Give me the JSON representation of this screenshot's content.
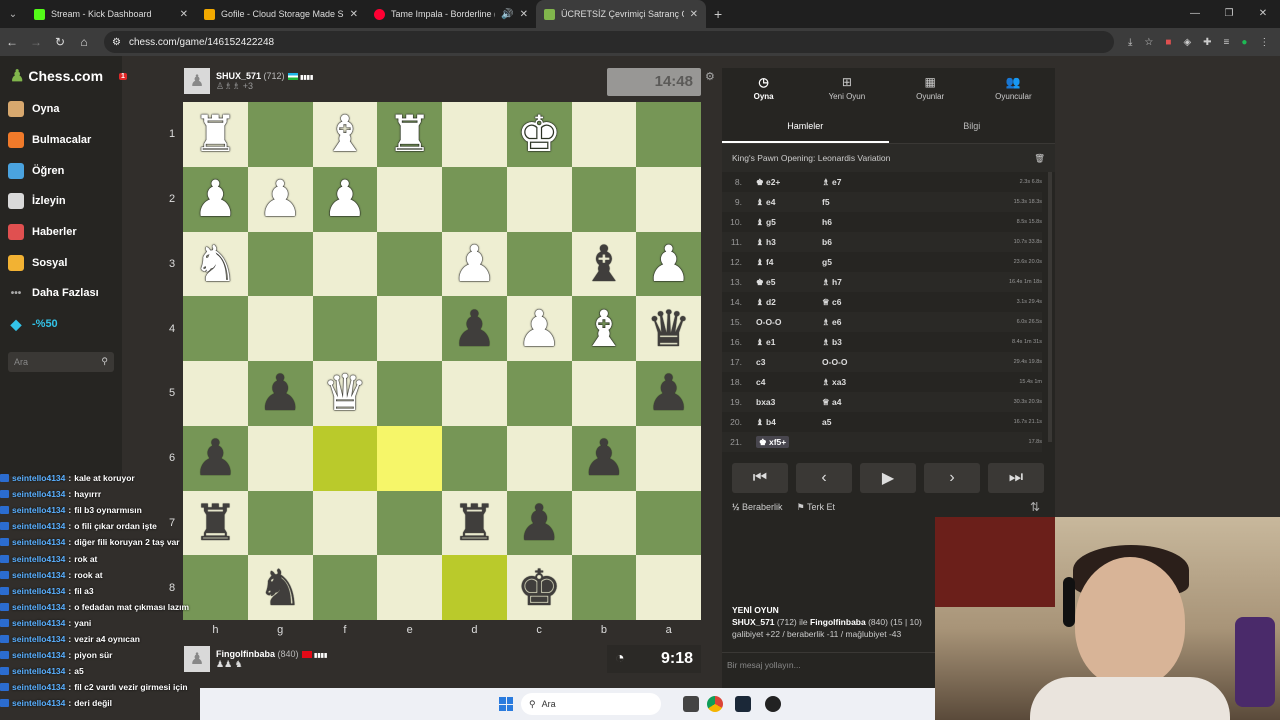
{
  "browser": {
    "tabs": [
      {
        "label": "Stream - Kick Dashboard",
        "color": "#53fc18",
        "active": false
      },
      {
        "label": "Gofile - Cloud Storage Made Si",
        "color": "#f2a900",
        "active": false
      },
      {
        "label": "Tame Impala - Borderline (",
        "color": "#ff0033",
        "active": false
      },
      {
        "label": "ÜCRETSİZ Çevrimiçi Satranç Oy",
        "color": "#81b64c",
        "active": true
      }
    ],
    "url": "chess.com/game/146152422248"
  },
  "sidebar": {
    "logo": "Chess.com",
    "notif_badge": "1",
    "items": [
      {
        "label": "Oyna",
        "icon": "play-hand-icon",
        "color": "#d7a86e"
      },
      {
        "label": "Bulmacalar",
        "icon": "puzzle-icon",
        "color": "#f07a2a"
      },
      {
        "label": "Öğren",
        "icon": "learn-icon",
        "color": "#4aa3df"
      },
      {
        "label": "İzleyin",
        "icon": "binoculars-icon",
        "color": "#d9d9d9"
      },
      {
        "label": "Haberler",
        "icon": "news-icon",
        "color": "#e05050"
      },
      {
        "label": "Sosyal",
        "icon": "social-icon",
        "color": "#f2b233"
      },
      {
        "label": "Daha Fazlası",
        "icon": "more-icon",
        "color": "#aaaaaa"
      },
      {
        "label": "-%50",
        "icon": "diamond-icon",
        "color": "#33c3e8"
      }
    ],
    "search_placeholder": "Ara"
  },
  "chat": [
    {
      "user": "seintello4134",
      "msg": "kale at koruyor"
    },
    {
      "user": "seintello4134",
      "msg": "hayırrr"
    },
    {
      "user": "seintello4134",
      "msg": "fil b3 oynarmısın"
    },
    {
      "user": "seintello4134",
      "msg": "o fili çıkar ordan işte"
    },
    {
      "user": "seintello4134",
      "msg": "diğer fili koruyan 2 taş var"
    },
    {
      "user": "seintello4134",
      "msg": "rok at"
    },
    {
      "user": "seintello4134",
      "msg": "rook at"
    },
    {
      "user": "seintello4134",
      "msg": "fil a3"
    },
    {
      "user": "seintello4134",
      "msg": "o fedadan mat çıkması lazım"
    },
    {
      "user": "seintello4134",
      "msg": "yani"
    },
    {
      "user": "seintello4134",
      "msg": "vezir a4 oynıcan"
    },
    {
      "user": "seintello4134",
      "msg": "piyon sür"
    },
    {
      "user": "seintello4134",
      "msg": "a5"
    },
    {
      "user": "seintello4134",
      "msg": "fil c2 vardı vezir girmesi için"
    },
    {
      "user": "seintello4134",
      "msg": "deri değil"
    }
  ],
  "top_player": {
    "name": "SHUX_571",
    "rating": "(712)",
    "captures": "+3",
    "clock": "14:48"
  },
  "bottom_player": {
    "name": "Fingolfinbaba",
    "rating": "(840)",
    "clock": "9:18"
  },
  "board": {
    "ranks": [
      "1",
      "2",
      "3",
      "4",
      "5",
      "6",
      "7",
      "8"
    ],
    "files": [
      "h",
      "g",
      "f",
      "e",
      "d",
      "c",
      "b",
      "a"
    ],
    "squares": [
      [
        "wR",
        "",
        "wB",
        "wR",
        "",
        "wK",
        "",
        ""
      ],
      [
        "wP",
        "wP",
        "wP",
        "",
        "",
        "",
        "",
        ""
      ],
      [
        "wN",
        "",
        "",
        "",
        "wP",
        "",
        "bB",
        "wP"
      ],
      [
        "",
        "",
        "",
        "",
        "bP",
        "wP",
        "wB",
        "bQ"
      ],
      [
        "",
        "bP",
        "wQ",
        "",
        "",
        "",
        "",
        "bP"
      ],
      [
        "bP",
        "",
        "",
        "",
        "",
        "",
        "bP",
        ""
      ],
      [
        "bR",
        "",
        "",
        "",
        "bR",
        "bP",
        "",
        ""
      ],
      [
        "",
        "bN",
        "",
        "",
        "",
        "bK",
        "",
        ""
      ]
    ],
    "highlighted": [
      "5-2",
      "5-3",
      "7-4"
    ]
  },
  "panel": {
    "tabs": [
      {
        "label": "Oyna",
        "icon": "clock-icon"
      },
      {
        "label": "Yeni Oyun",
        "icon": "plus-icon"
      },
      {
        "label": "Oyunlar",
        "icon": "board-icon"
      },
      {
        "label": "Oyuncular",
        "icon": "players-icon"
      }
    ],
    "subtabs": [
      "Hamleler",
      "Bilgi"
    ],
    "opening": "King's Pawn Opening: Leonardis Variation",
    "moves": [
      {
        "n": "8.",
        "w": "♚ e2+",
        "b": "♗ e7",
        "t": "2.3s 6.8s"
      },
      {
        "n": "9.",
        "w": "♝ e4",
        "b": "f5",
        "t": "15.3s 18.3s"
      },
      {
        "n": "10.",
        "w": "♝ g5",
        "b": "h6",
        "t": "8.5s 15.8s"
      },
      {
        "n": "11.",
        "w": "♝ h3",
        "b": "b6",
        "t": "10.7s 33.8s"
      },
      {
        "n": "12.",
        "w": "♝ f4",
        "b": "g5",
        "t": "23.6s 20.0s"
      },
      {
        "n": "13.",
        "w": "♚ e5",
        "b": "♗ h7",
        "t": "16.4s 1m 18s"
      },
      {
        "n": "14.",
        "w": "♝ d2",
        "b": "♕ c6",
        "t": "3.1s 29.4s"
      },
      {
        "n": "15.",
        "w": "O-O-O",
        "b": "♗ e6",
        "t": "6.0s 26.5s"
      },
      {
        "n": "16.",
        "w": "♝ e1",
        "b": "♗ b3",
        "t": "8.4s 1m 31s"
      },
      {
        "n": "17.",
        "w": "c3",
        "b": "O-O-O",
        "t": "29.4s 19.8s"
      },
      {
        "n": "18.",
        "w": "c4",
        "b": "♗ xa3",
        "t": "15.4s 1m"
      },
      {
        "n": "19.",
        "w": "bxa3",
        "b": "♕ a4",
        "t": "30.3s 20.9s"
      },
      {
        "n": "20.",
        "w": "♝ b4",
        "b": "a5",
        "t": "16.7s 21.1s"
      },
      {
        "n": "21.",
        "w": "♚ xf5+",
        "b": "",
        "t": "17.8s"
      }
    ],
    "draw": "Beraberlik",
    "resign": "Terk Et",
    "newgame_title": "YENİ OYUN",
    "newgame_line1_a": "SHUX_571",
    "newgame_line1_b": "(712) ile",
    "newgame_line1_c": "Fingolfinbaba",
    "newgame_line1_d": "(840) (15 | 10)",
    "newgame_line2": "galibiyet +22 / beraberlik -11 / mağlubiyet -43",
    "message_placeholder": "Bir mesaj yollayın..."
  },
  "taskbar": {
    "search": "Ara"
  },
  "chat_overlay_extra": {
    "settings1": "Ayarlar",
    "settings2": "Ayarlar"
  }
}
